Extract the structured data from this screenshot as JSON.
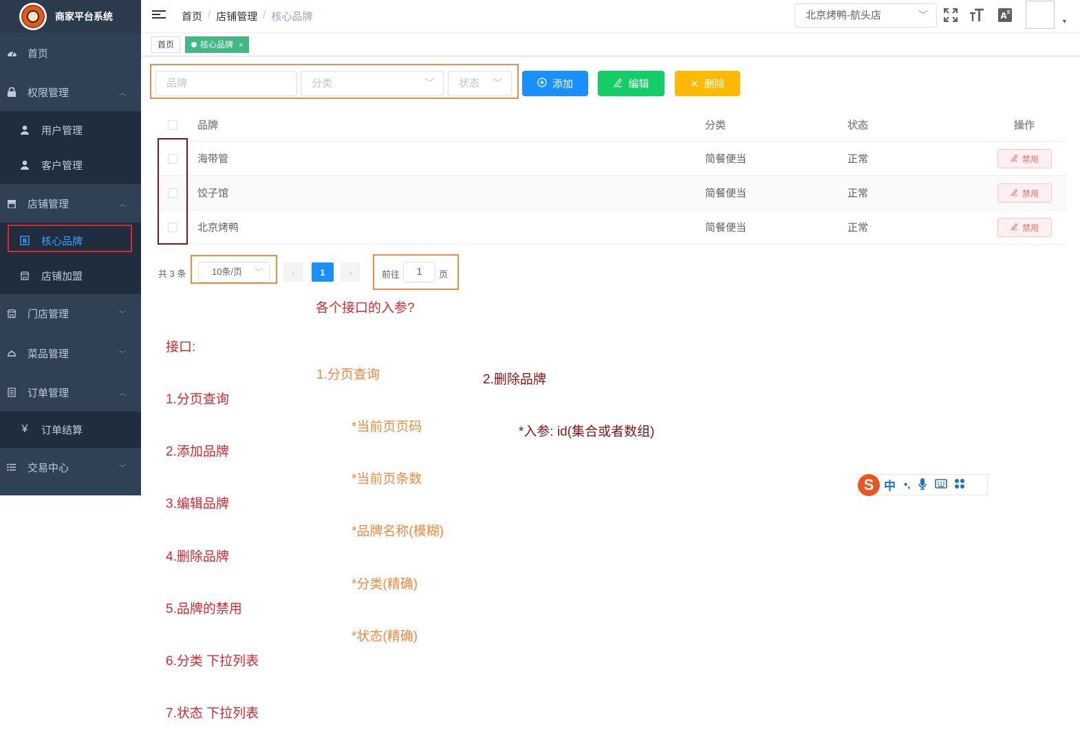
{
  "app": {
    "title": "商家平台系统"
  },
  "sidebar": {
    "items": [
      {
        "label": "首页",
        "icon": "dashboard-icon"
      },
      {
        "label": "权限管理",
        "icon": "lock-icon",
        "expanded": true,
        "children": [
          {
            "label": "用户管理",
            "icon": "user-icon"
          },
          {
            "label": "客户管理",
            "icon": "user-icon"
          }
        ]
      },
      {
        "label": "店铺管理",
        "icon": "shop-icon",
        "expanded": true,
        "children": [
          {
            "label": "核心品牌",
            "icon": "brand-icon",
            "active": true
          },
          {
            "label": "店铺加盟",
            "icon": "store-icon"
          }
        ]
      },
      {
        "label": "门店管理",
        "icon": "store-icon"
      },
      {
        "label": "菜品管理",
        "icon": "dish-icon"
      },
      {
        "label": "订单管理",
        "icon": "list-icon",
        "expanded": true,
        "children": [
          {
            "label": "订单结算",
            "icon": "yen-icon"
          }
        ]
      },
      {
        "label": "交易中心",
        "icon": "menu-list-icon"
      }
    ]
  },
  "header": {
    "breadcrumb": [
      "首页",
      "店铺管理",
      "核心品牌"
    ],
    "store_select": "北京烤鸭-航头店"
  },
  "tags": [
    {
      "label": "首页"
    },
    {
      "label": "核心品牌",
      "active": true
    }
  ],
  "filters": {
    "brand_placeholder": "品牌",
    "category_placeholder": "分类",
    "status_placeholder": "状态"
  },
  "buttons": {
    "add": "添加",
    "edit": "编辑",
    "delete": "删除"
  },
  "table": {
    "columns": [
      "品牌",
      "分类",
      "状态",
      "操作"
    ],
    "rows": [
      {
        "brand": "海带管",
        "category": "简餐便当",
        "status": "正常",
        "action": "禁用"
      },
      {
        "brand": "饺子馆",
        "category": "简餐便当",
        "status": "正常",
        "action": "禁用"
      },
      {
        "brand": "北京烤鸭",
        "category": "简餐便当",
        "status": "正常",
        "action": "禁用"
      }
    ]
  },
  "pagination": {
    "total_text": "共 3 条",
    "page_size": "10条/页",
    "current_page": "1",
    "goto_label": "前往",
    "goto_value": "1",
    "goto_unit": "页"
  },
  "notes": {
    "interfaces": [
      "接口:",
      "1.分页查询",
      "2.添加品牌",
      "3.编辑品牌",
      "4.删除品牌",
      "5.品牌的禁用",
      "6.分类 下拉列表",
      "7.状态 下拉列表"
    ],
    "params_title": "各个接口的入参?",
    "paging_params": [
      "1.分页查询",
      "*当前页页码",
      "*当前页条数",
      "*品牌名称(模糊)",
      "*分类(精确)",
      "*状态(精确)"
    ],
    "delete_params": [
      "2.删除品牌",
      "*入参: id(集合或者数组)"
    ]
  },
  "ime": {
    "mode": "中",
    "punct": "•,"
  },
  "colors": {
    "sidebar": "#304156",
    "submenu": "#1f2d3d",
    "primary": "#1890ff",
    "success": "#13ce66",
    "warning": "#ffba00",
    "danger": "#f56c6c",
    "tag_active": "#42b983",
    "annotation_red": "#e3262e",
    "annotation_orange": "#f58a3d"
  }
}
